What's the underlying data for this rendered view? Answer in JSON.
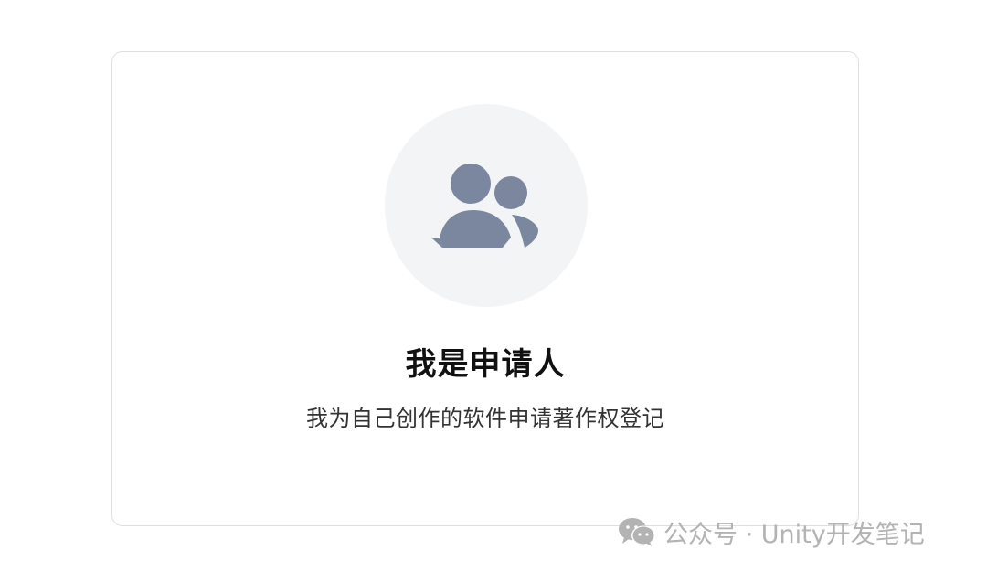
{
  "card": {
    "title": "我是申请人",
    "description": "我为自己创作的软件申请著作权登记",
    "icon": "users-icon"
  },
  "watermark": {
    "icon": "wechat-icon",
    "text": "公众号 · Unity开发笔记"
  },
  "colors": {
    "card_border": "#dcdfe3",
    "icon_circle_bg": "#f3f4f6",
    "icon_fill": "#7a879e",
    "title": "#111111",
    "description": "#333333",
    "watermark": "#b3b3b3"
  }
}
